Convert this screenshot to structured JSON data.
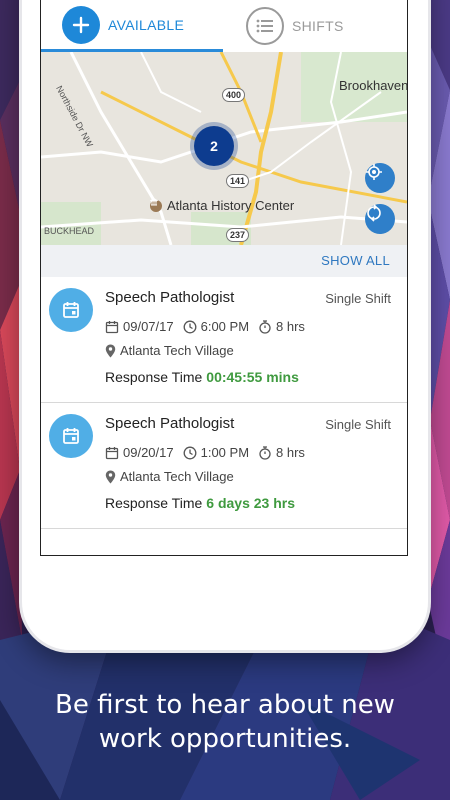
{
  "tabs": {
    "available_label": "AVAILABLE",
    "shifts_label": "SHIFTS",
    "active": "available"
  },
  "map": {
    "labels": {
      "brookhaven": "Brookhaven",
      "northside": "Northside Dr NW",
      "poi": "Atlanta History Center",
      "buckhead": "BUCKHEAD"
    },
    "highway_shields": [
      "400",
      "141",
      "237"
    ],
    "cluster_count": "2"
  },
  "show_all_label": "SHOW ALL",
  "jobs": [
    {
      "title": "Speech Pathologist",
      "shift_type": "Single Shift",
      "date": "09/07/17",
      "time": "6:00 PM",
      "duration": "8 hrs",
      "location": "Atlanta Tech Village",
      "response_label": "Response Time",
      "response_value": "00:45:55 mins"
    },
    {
      "title": "Speech Pathologist",
      "shift_type": "Single Shift",
      "date": "09/20/17",
      "time": "1:00 PM",
      "duration": "8 hrs",
      "location": "Atlanta Tech Village",
      "response_label": "Response Time",
      "response_value": "6 days 23 hrs"
    }
  ],
  "tagline": {
    "line1": "Be first to hear about new",
    "line2": "work opportunities."
  },
  "colors": {
    "accent": "#1e88d8",
    "cluster": "#0d3c8f",
    "response_green": "#3f9a3f",
    "card_icon": "#50aee6"
  }
}
